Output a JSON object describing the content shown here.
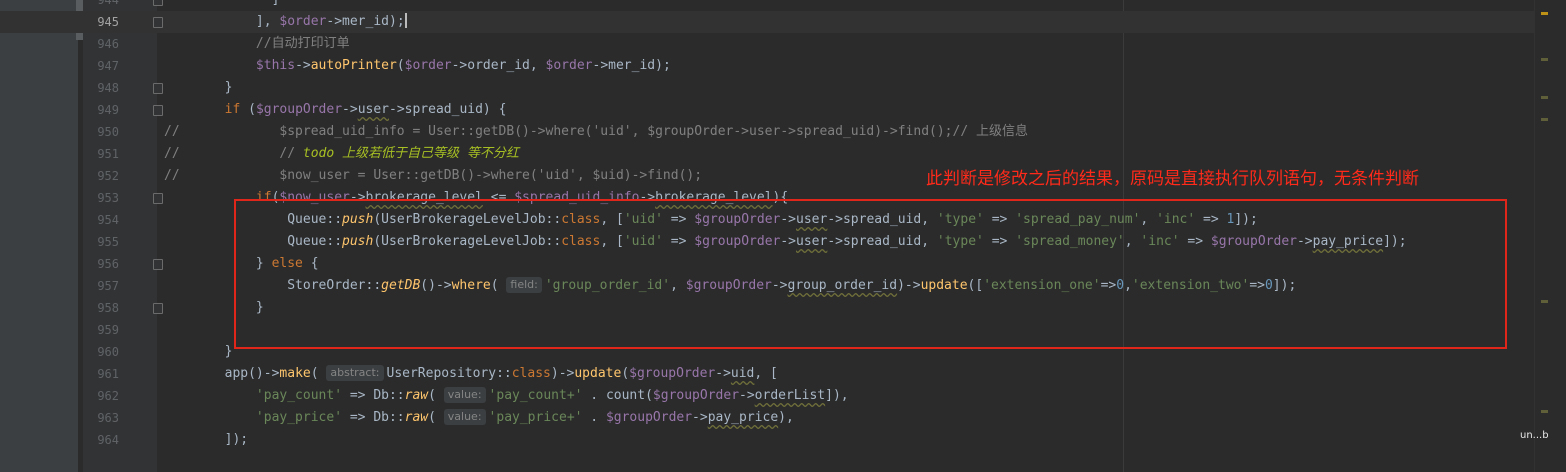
{
  "editor": {
    "current_line": "945",
    "lines": [
      {
        "num": "944",
        "indent": "          ",
        "tokens": [
          [
            "p",
            "]"
          ]
        ]
      },
      {
        "num": "945",
        "indent": "        ",
        "tokens": [
          [
            "p",
            "], "
          ],
          [
            "var",
            "$order"
          ],
          [
            "p",
            "->mer_id);"
          ]
        ]
      },
      {
        "num": "946",
        "indent": "        ",
        "tokens": [
          [
            "cmt",
            "//自动打印订单"
          ]
        ]
      },
      {
        "num": "947",
        "indent": "        ",
        "tokens": [
          [
            "var",
            "$this"
          ],
          [
            "p",
            "->"
          ],
          [
            "fn",
            "autoPrinter"
          ],
          [
            "p",
            "("
          ],
          [
            "var",
            "$order"
          ],
          [
            "p",
            "->order_id, "
          ],
          [
            "var",
            "$order"
          ],
          [
            "p",
            "->mer_id);"
          ]
        ]
      },
      {
        "num": "948",
        "indent": "    ",
        "tokens": [
          [
            "p",
            "}"
          ]
        ]
      },
      {
        "num": "949",
        "indent": "    ",
        "tokens": [
          [
            "kw",
            "if "
          ],
          [
            "p",
            "("
          ],
          [
            "var",
            "$groupOrder"
          ],
          [
            "p",
            "->"
          ],
          [
            "wavy",
            "user"
          ],
          [
            "p",
            "->spread_uid) {"
          ]
        ]
      },
      {
        "num": "950",
        "comment": "//",
        "indent": "           ",
        "tokens": [
          [
            "cmt",
            "$spread_uid_info = User::getDB()->where('uid', $groupOrder->user->spread_uid)->find();// 上级信息"
          ]
        ]
      },
      {
        "num": "951",
        "comment": "//",
        "indent": "           ",
        "tokens": [
          [
            "cmt",
            "// "
          ],
          [
            "todo",
            "todo 上级若低于自己等级 等不分红"
          ]
        ]
      },
      {
        "num": "952",
        "comment": "//",
        "indent": "           ",
        "tokens": [
          [
            "cmt",
            "$now_user = User::getDB()->where('uid', $uid)->find();"
          ]
        ]
      },
      {
        "num": "953",
        "indent": "        ",
        "tokens": [
          [
            "kw",
            "if"
          ],
          [
            "p",
            "("
          ],
          [
            "var",
            "$now_user"
          ],
          [
            "p",
            "->"
          ],
          [
            "wavy",
            "brokerage_level"
          ],
          [
            "p",
            " <= "
          ],
          [
            "var",
            "$spread_uid_info"
          ],
          [
            "p",
            "->"
          ],
          [
            "wavy",
            "brokerage_level"
          ],
          [
            "p",
            "){"
          ]
        ]
      },
      {
        "num": "954",
        "indent": "            ",
        "tokens": [
          [
            "p",
            "Queue::"
          ],
          [
            "fn-i",
            "push"
          ],
          [
            "p",
            "(UserBrokerageLevelJob::"
          ],
          [
            "kw",
            "class"
          ],
          [
            "p",
            ", ["
          ],
          [
            "str",
            "'uid'"
          ],
          [
            "p",
            " => "
          ],
          [
            "var",
            "$groupOrder"
          ],
          [
            "p",
            "->"
          ],
          [
            "wavy",
            "user"
          ],
          [
            "p",
            "->spread_uid, "
          ],
          [
            "str",
            "'type'"
          ],
          [
            "p",
            " => "
          ],
          [
            "str",
            "'spread_pay_num'"
          ],
          [
            "p",
            ", "
          ],
          [
            "str",
            "'inc'"
          ],
          [
            "p",
            " => "
          ],
          [
            "num",
            "1"
          ],
          [
            "p",
            "]);"
          ]
        ]
      },
      {
        "num": "955",
        "indent": "            ",
        "tokens": [
          [
            "p",
            "Queue::"
          ],
          [
            "fn-i",
            "push"
          ],
          [
            "p",
            "(UserBrokerageLevelJob::"
          ],
          [
            "kw",
            "class"
          ],
          [
            "p",
            ", ["
          ],
          [
            "str",
            "'uid'"
          ],
          [
            "p",
            " => "
          ],
          [
            "var",
            "$groupOrder"
          ],
          [
            "p",
            "->"
          ],
          [
            "wavy",
            "user"
          ],
          [
            "p",
            "->spread_uid, "
          ],
          [
            "str",
            "'type'"
          ],
          [
            "p",
            " => "
          ],
          [
            "str",
            "'spread_money'"
          ],
          [
            "p",
            ", "
          ],
          [
            "str",
            "'inc'"
          ],
          [
            "p",
            " => "
          ],
          [
            "var",
            "$groupOrder"
          ],
          [
            "p",
            "->"
          ],
          [
            "wavy",
            "pay_price"
          ],
          [
            "p",
            "]);"
          ]
        ]
      },
      {
        "num": "956",
        "indent": "        ",
        "tokens": [
          [
            "p",
            "} "
          ],
          [
            "kw",
            "else"
          ],
          [
            "p",
            " {"
          ]
        ]
      },
      {
        "num": "957",
        "indent": "            ",
        "tokens": [
          [
            "p",
            "StoreOrder::"
          ],
          [
            "fn-i",
            "getDB"
          ],
          [
            "p",
            "()->"
          ],
          [
            "fn",
            "where"
          ],
          [
            "p",
            "( "
          ],
          [
            "hint",
            "field:"
          ],
          [
            "str",
            "'group_order_id'"
          ],
          [
            "p",
            ", "
          ],
          [
            "var",
            "$groupOrder"
          ],
          [
            "p",
            "->"
          ],
          [
            "wavy",
            "group_order_id"
          ],
          [
            "p",
            ")->"
          ],
          [
            "fn",
            "update"
          ],
          [
            "p",
            "(["
          ],
          [
            "str",
            "'extension_one'"
          ],
          [
            "p",
            "=>"
          ],
          [
            "num",
            "0"
          ],
          [
            "p",
            ","
          ],
          [
            "str",
            "'extension_two'"
          ],
          [
            "p",
            "=>"
          ],
          [
            "num",
            "0"
          ],
          [
            "p",
            "]);"
          ]
        ]
      },
      {
        "num": "958",
        "indent": "        ",
        "tokens": [
          [
            "p",
            "}"
          ]
        ]
      },
      {
        "num": "959",
        "indent": "",
        "tokens": []
      },
      {
        "num": "960",
        "indent": "    ",
        "tokens": [
          [
            "p",
            "}"
          ]
        ]
      },
      {
        "num": "961",
        "indent": "    ",
        "tokens": [
          [
            "p",
            "app()->"
          ],
          [
            "fn",
            "make"
          ],
          [
            "p",
            "( "
          ],
          [
            "hint",
            "abstract:"
          ],
          [
            "p",
            "UserRepository::"
          ],
          [
            "kw",
            "class"
          ],
          [
            "p",
            ")->"
          ],
          [
            "fn",
            "update"
          ],
          [
            "p",
            "("
          ],
          [
            "var",
            "$groupOrder"
          ],
          [
            "p",
            "->"
          ],
          [
            "wavy",
            "uid"
          ],
          [
            "p",
            ", ["
          ]
        ]
      },
      {
        "num": "962",
        "indent": "        ",
        "tokens": [
          [
            "str",
            "'pay_count'"
          ],
          [
            "p",
            " => Db::"
          ],
          [
            "fn-i",
            "raw"
          ],
          [
            "p",
            "( "
          ],
          [
            "hint",
            "value:"
          ],
          [
            "str",
            "'pay_count+'"
          ],
          [
            "p",
            " . count("
          ],
          [
            "var",
            "$groupOrder"
          ],
          [
            "p",
            "->"
          ],
          [
            "wavy",
            "orderList"
          ],
          [
            "p",
            "]),"
          ]
        ]
      },
      {
        "num": "963",
        "indent": "        ",
        "tokens": [
          [
            "str",
            "'pay_price'"
          ],
          [
            "p",
            " => Db::"
          ],
          [
            "fn-i",
            "raw"
          ],
          [
            "p",
            "( "
          ],
          [
            "hint",
            "value:"
          ],
          [
            "str",
            "'pay_price+'"
          ],
          [
            "p",
            " . "
          ],
          [
            "var",
            "$groupOrder"
          ],
          [
            "p",
            "->"
          ],
          [
            "wavy",
            "pay_price"
          ],
          [
            "p",
            "),"
          ]
        ]
      },
      {
        "num": "964",
        "indent": "    ",
        "tokens": [
          [
            "p",
            "]);"
          ]
        ]
      }
    ]
  },
  "annotation": {
    "text": "此判断是修改之后的结果，原码是直接执行队列语句，无条件判断"
  },
  "watermark": "un...b",
  "colors": {
    "annotation": "#e0251b",
    "background": "#2b2b2b"
  }
}
